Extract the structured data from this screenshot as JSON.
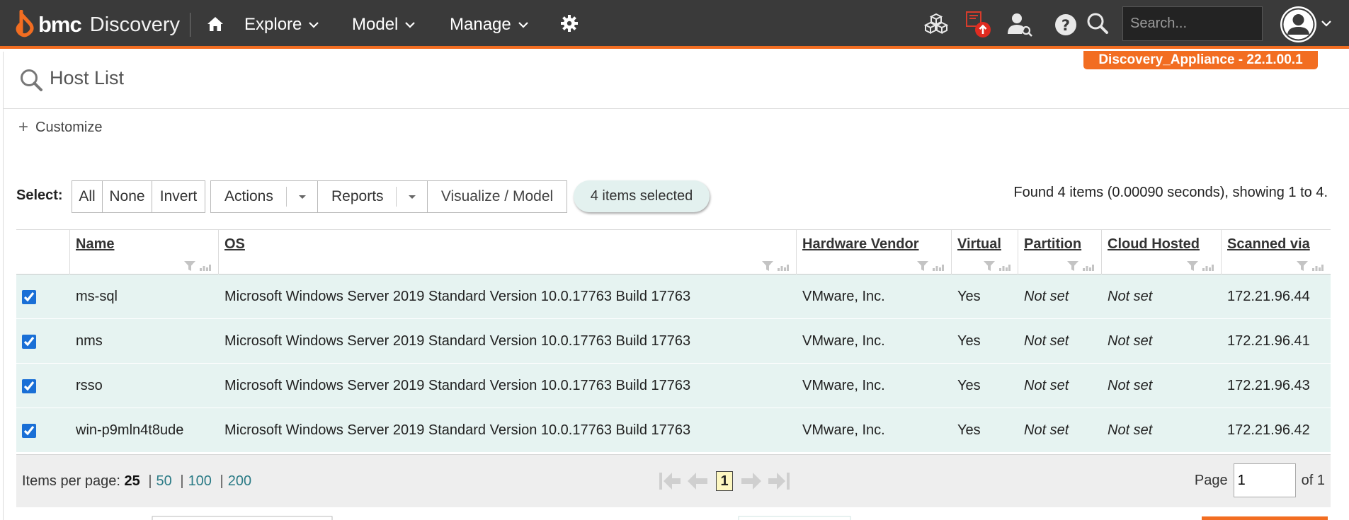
{
  "nav": {
    "brand": "bmc",
    "product": "Discovery",
    "explore": "Explore",
    "model": "Model",
    "manage": "Manage",
    "search_placeholder": "Search..."
  },
  "appliance": "Discovery_Appliance - 22.1.00.1",
  "page": {
    "title": "Host List",
    "customize": "Customize"
  },
  "toolbar": {
    "select_label": "Select:",
    "all": "All",
    "none": "None",
    "invert": "Invert",
    "actions": "Actions",
    "reports": "Reports",
    "visualize": "Visualize / Model",
    "selected": "4 items selected",
    "found": "Found 4 items (0.00090 seconds), showing 1 to 4."
  },
  "table": {
    "columns": [
      "Name",
      "OS",
      "Hardware Vendor",
      "Virtual",
      "Partition",
      "Cloud Hosted",
      "Scanned via"
    ],
    "rows": [
      {
        "name": "ms-sql",
        "os": "Microsoft Windows Server 2019 Standard Version 10.0.17763 Build 17763",
        "vendor": "VMware, Inc.",
        "virtual": "Yes",
        "partition": "Not set",
        "cloud": "Not set",
        "scanned": "172.21.96.44"
      },
      {
        "name": "nms",
        "os": "Microsoft Windows Server 2019 Standard Version 10.0.17763 Build 17763",
        "vendor": "VMware, Inc.",
        "virtual": "Yes",
        "partition": "Not set",
        "cloud": "Not set",
        "scanned": "172.21.96.41"
      },
      {
        "name": "rsso",
        "os": "Microsoft Windows Server 2019 Standard Version 10.0.17763 Build 17763",
        "vendor": "VMware, Inc.",
        "virtual": "Yes",
        "partition": "Not set",
        "cloud": "Not set",
        "scanned": "172.21.96.43"
      },
      {
        "name": "win-p9mln4t8ude",
        "os": "Microsoft Windows Server 2019 Standard Version 10.0.17763 Build 17763",
        "vendor": "VMware, Inc.",
        "virtual": "Yes",
        "partition": "Not set",
        "cloud": "Not set",
        "scanned": "172.21.96.42"
      }
    ]
  },
  "pager": {
    "ipp_label": "Items per page:",
    "ipp_current": "25",
    "ipp_options": [
      "50",
      "100",
      "200"
    ],
    "current_page": "1",
    "page_label": "Page",
    "page_value": "1",
    "of_label": "of 1"
  },
  "colors": {
    "topbar": "#3a3a3a",
    "accent": "#f26d21",
    "row_bg": "#e6f3f1",
    "link": "#2b7b86"
  },
  "icons": [
    "bmc-logo-icon",
    "home-icon",
    "chevron-down-icon",
    "gear-icon",
    "cubes-icon",
    "alert-upload-icon",
    "user-search-icon",
    "help-icon",
    "search-icon",
    "user-avatar-icon",
    "filter-icon",
    "bar-chart-icon",
    "first-page-icon",
    "prev-page-icon",
    "next-page-icon",
    "last-page-icon"
  ]
}
